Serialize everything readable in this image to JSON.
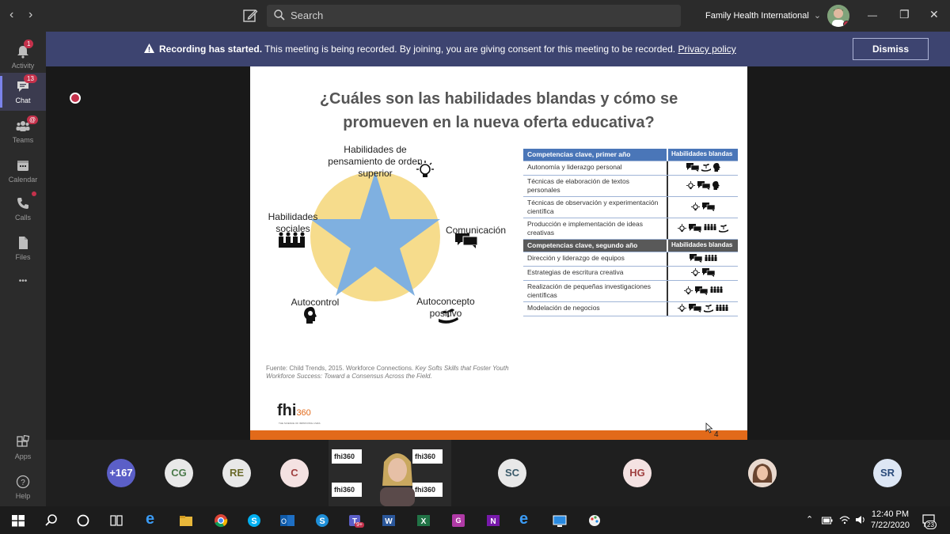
{
  "titlebar": {
    "back": "‹",
    "forward": "›",
    "search_placeholder": "Search",
    "org_name": "Family Health International",
    "org_chevron": "⌄",
    "minimize": "—",
    "maximize": "❐",
    "close": "✕"
  },
  "rail": {
    "activity": {
      "label": "Activity",
      "badge": "1"
    },
    "chat": {
      "label": "Chat",
      "badge": "13"
    },
    "teams": {
      "label": "Teams"
    },
    "calendar": {
      "label": "Calendar"
    },
    "calls": {
      "label": "Calls"
    },
    "files": {
      "label": "Files"
    },
    "more": "•••",
    "apps": {
      "label": "Apps"
    },
    "help": {
      "label": "Help"
    }
  },
  "banner": {
    "bold": "Recording has started.",
    "text": " This meeting is being recorded. By joining, you are giving consent for this meeting to be recorded. ",
    "link": "Privacy policy",
    "dismiss": "Dismiss"
  },
  "slide": {
    "title_line1": "¿Cuáles son las habilidades blandas y cómo se",
    "title_line2": "promueven en la nueva oferta educativa?",
    "labels": {
      "top": "Habilidades de pensamiento de orden superior",
      "left": "Habilidades sociales",
      "right": "Comunicación",
      "bottom_left": "Autocontrol",
      "bottom_right": "Autoconcepto positivo"
    },
    "table": {
      "header1": {
        "c1": "Competencias clave, primer año",
        "c2": "Habilidades blandas"
      },
      "rows1": [
        {
          "c1": "Autonomía y liderazgo personal",
          "icons": [
            "chat",
            "plant",
            "head"
          ]
        },
        {
          "c1": "Técnicas de elaboración de textos personales",
          "icons": [
            "bulb",
            "chat",
            "head"
          ]
        },
        {
          "c1": "Técnicas de observación y experimentación científica",
          "icons": [
            "bulb",
            "chat"
          ]
        },
        {
          "c1": "Producción e implementación de ideas creativas",
          "icons": [
            "bulb",
            "chat",
            "people",
            "plant"
          ]
        }
      ],
      "header2": {
        "c1": "Competencias clave, segundo año",
        "c2": "Habilidades blandas"
      },
      "rows2": [
        {
          "c1": "Dirección y liderazgo de equipos",
          "icons": [
            "chat",
            "people"
          ]
        },
        {
          "c1": "Estrategias de escritura creativa",
          "icons": [
            "bulb",
            "chat"
          ]
        },
        {
          "c1": "Realización de pequeñas investigaciones científicas",
          "icons": [
            "bulb",
            "chat",
            "people"
          ]
        },
        {
          "c1": "Modelación de negocios",
          "icons": [
            "bulb",
            "chat",
            "plant",
            "people"
          ]
        }
      ]
    },
    "source_prefix": "Fuente: Child Trends, 2015. Workforce Connections. ",
    "source_italic": "Key Softs Skills that Foster Youth Workforce Success: Toward a Consensus Across the Field.",
    "logo_main": "fhi",
    "logo_num": "360",
    "logo_sub": "THE SCIENCE OF IMPROVING LIVES",
    "page_number": "4"
  },
  "participants": {
    "overflow": "+167",
    "list": [
      {
        "initials": "CG",
        "bg": "#e8e8e8",
        "fg": "#4a7a4a"
      },
      {
        "initials": "RE",
        "bg": "#e8e8e8",
        "fg": "#6a6a2a"
      },
      {
        "initials": "C",
        "bg": "#f4e2e2",
        "fg": "#a04040"
      },
      {
        "initials": "SC",
        "bg": "#e8e8e8",
        "fg": "#3a5a6a"
      },
      {
        "initials": "HG",
        "bg": "#f4e2e2",
        "fg": "#a04040"
      },
      {
        "initials": "SR",
        "bg": "#dde6f4",
        "fg": "#2a4a7a"
      }
    ],
    "mini_logo": "fhi360"
  },
  "taskbar": {
    "time": "12:40 PM",
    "date": "7/22/2020",
    "notifications": "23",
    "teams_badge": "9+"
  },
  "colors": {
    "banner": "#3d4470",
    "accent": "#7b83eb",
    "slide_orange": "#e26a1a",
    "table_blue": "#4a76b8",
    "star": "#7fb0e0",
    "circle": "#f6dc8c"
  }
}
